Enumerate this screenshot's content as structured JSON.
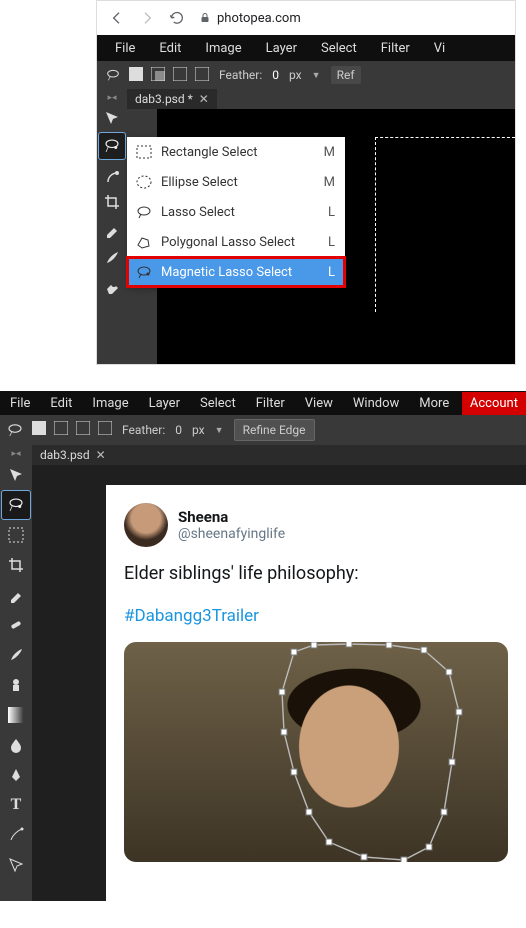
{
  "top": {
    "url": "photopea.com",
    "menus": [
      "File",
      "Edit",
      "Image",
      "Layer",
      "Select",
      "Filter",
      "Vi"
    ],
    "options": {
      "feather_label": "Feather:",
      "feather_value": "0",
      "unit": "px",
      "refine": "Ref"
    },
    "tab": {
      "name": "dab3.psd *"
    },
    "flyout": [
      {
        "label": "Rectangle Select",
        "key": "M"
      },
      {
        "label": "Ellipse Select",
        "key": "M"
      },
      {
        "label": "Lasso Select",
        "key": "L"
      },
      {
        "label": "Polygonal Lasso Select",
        "key": "L"
      },
      {
        "label": "Magnetic Lasso Select",
        "key": "L"
      }
    ]
  },
  "bottom": {
    "menus": [
      "File",
      "Edit",
      "Image",
      "Layer",
      "Select",
      "Filter",
      "View",
      "Window",
      "More"
    ],
    "account": "Account",
    "options": {
      "feather_label": "Feather:",
      "feather_value": "0",
      "unit": "px",
      "refine": "Refine Edge"
    },
    "tab": {
      "name": "dab3.psd"
    },
    "tweet": {
      "name": "Sheena",
      "handle": "@sheenafyinglife",
      "body": "Elder siblings' life philosophy:",
      "hashtag": "#Dabangg3Trailer"
    }
  }
}
